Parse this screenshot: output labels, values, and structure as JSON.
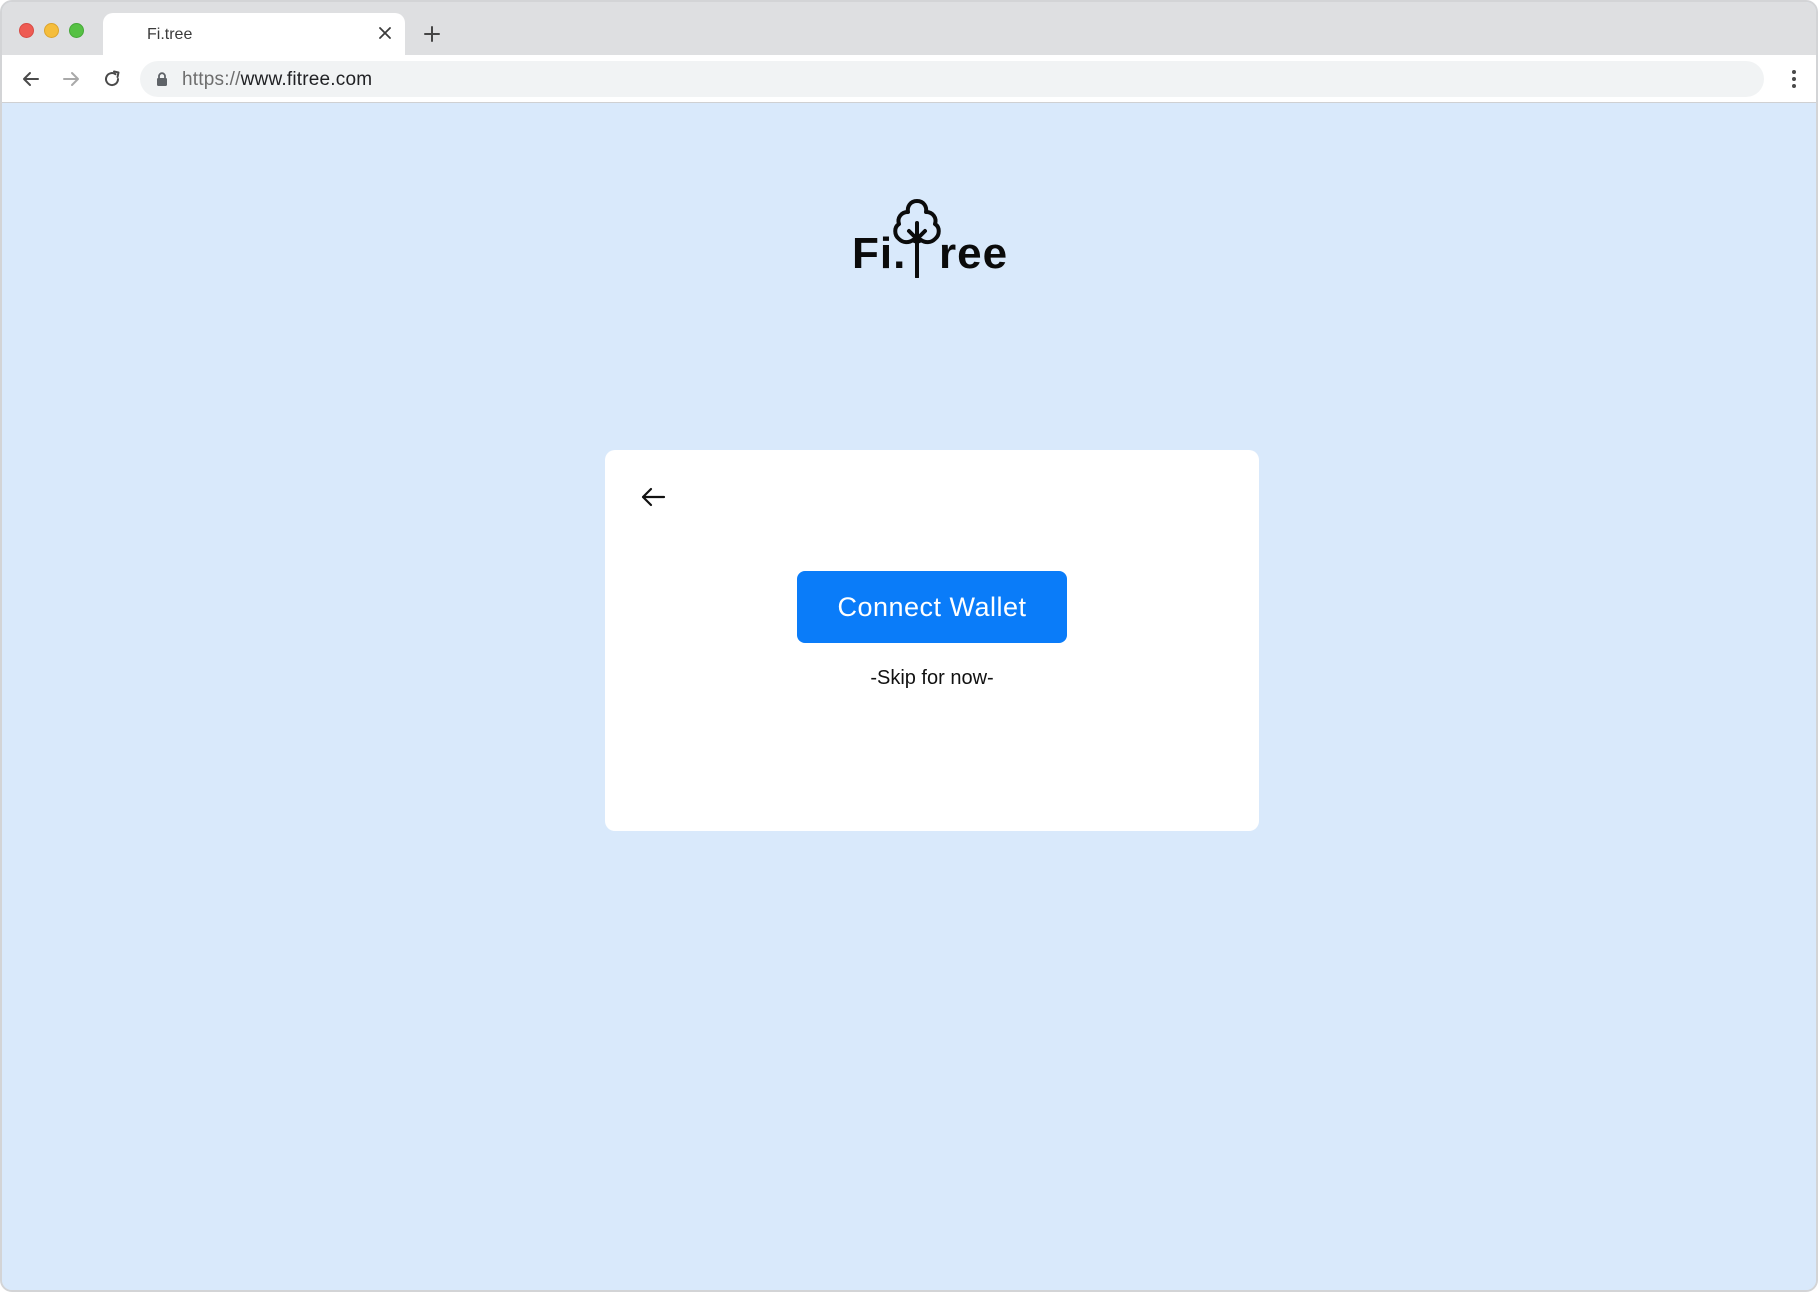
{
  "browser": {
    "tab_title": "Fi.tree",
    "url_scheme": "https://",
    "url_host": "www.fitree.com",
    "icons": {
      "close": "close-icon",
      "new_tab": "plus-icon",
      "back": "arrow-left-icon",
      "forward": "arrow-right-icon",
      "reload": "reload-icon",
      "lock": "lock-icon",
      "menu": "kebab-menu-icon"
    }
  },
  "logo": {
    "text_left": "Fi.",
    "text_right": "ree",
    "icon": "tree-icon"
  },
  "card": {
    "back_icon": "arrow-left-icon",
    "connect_label": "Connect Wallet",
    "skip_label": "-Skip for now-"
  },
  "colors": {
    "page_background": "#d9e9fb",
    "primary_button": "#0a7cf9",
    "card_background": "#ffffff"
  }
}
